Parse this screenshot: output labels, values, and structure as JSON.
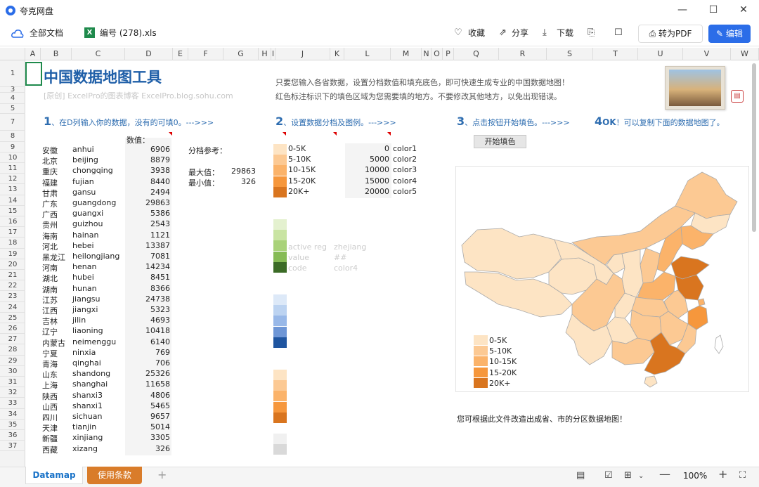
{
  "window": {
    "app_name": "夸克网盘",
    "min": "—",
    "max": "☐",
    "close": "✕"
  },
  "toolbar": {
    "all_docs": "全部文档",
    "file_name": "编号 (278).xls",
    "favorite": "收藏",
    "share": "分享",
    "download": "下载",
    "to_pdf": "转为PDF",
    "edit": "编辑"
  },
  "columns": [
    "A",
    "B",
    "C",
    "D",
    "E",
    "F",
    "G",
    "H",
    "I",
    "J",
    "K",
    "L",
    "M",
    "N",
    "O",
    "P",
    "Q",
    "R",
    "S",
    "T",
    "U",
    "V",
    "W"
  ],
  "rows": [
    "1",
    "3",
    "4",
    "5",
    "7",
    "8",
    "9",
    "10",
    "11",
    "12",
    "13",
    "14",
    "15",
    "16",
    "17",
    "18",
    "19",
    "20",
    "21",
    "22",
    "23",
    "24",
    "25",
    "26",
    "27",
    "28",
    "29",
    "30",
    "31",
    "32",
    "33",
    "34",
    "35",
    "36",
    "37"
  ],
  "sheet": {
    "title": "中国数据地图工具",
    "subtitle": "[原创] ExcelPro的图表博客 ExcelPro.blog.sohu.com",
    "intro1": "只要您输入各省数据，设置分档数值和填充底色，即可快速生成专业的中国数据地图！",
    "intro2": "红色标注标识下的填色区域为您需要填的地方。不要修改其他地方，以免出现错误。",
    "step1_num": "1",
    "step1_text": "、在D列输入你的数据，没有的可填0。--->>>",
    "step2_num": "2",
    "step2_text": "、设置数据分档及图例。--->>>",
    "step3_num": "3",
    "step3_text": "、点击按钮开始填色。--->>>",
    "step4_num": "4",
    "step4_ok": "OK",
    "step4_text": "！可以复制下面的数据地图了。",
    "value_header": "数值：",
    "fill_button": "开始填色",
    "ref_label": "分档参考：",
    "max_label": "最大值：",
    "max_value": "29863",
    "min_label": "最小值：",
    "min_value": "326",
    "bottom_note": "您可根据此文件改造出成省、市的分区数据地图！",
    "hidden1_a": "active reg",
    "hidden1_b": "zhejiang",
    "hidden2_a": "value",
    "hidden2_b": "##",
    "hidden3_a": "code",
    "hidden3_b": "color4"
  },
  "provinces": [
    {
      "cn": "安徽",
      "py": "anhui",
      "v": "6906"
    },
    {
      "cn": "北京",
      "py": "beijing",
      "v": "8879"
    },
    {
      "cn": "重庆",
      "py": "chongqing",
      "v": "3938"
    },
    {
      "cn": "福建",
      "py": "fujian",
      "v": "8440"
    },
    {
      "cn": "甘肃",
      "py": "gansu",
      "v": "2494"
    },
    {
      "cn": "广东",
      "py": "guangdong",
      "v": "29863"
    },
    {
      "cn": "广西",
      "py": "guangxi",
      "v": "5386"
    },
    {
      "cn": "贵州",
      "py": "guizhou",
      "v": "2543"
    },
    {
      "cn": "海南",
      "py": "hainan",
      "v": "1121"
    },
    {
      "cn": "河北",
      "py": "hebei",
      "v": "13387"
    },
    {
      "cn": "黑龙江",
      "py": "heilongjiang",
      "v": "7081"
    },
    {
      "cn": "河南",
      "py": "henan",
      "v": "14234"
    },
    {
      "cn": "湖北",
      "py": "hubei",
      "v": "8451"
    },
    {
      "cn": "湖南",
      "py": "hunan",
      "v": "8366"
    },
    {
      "cn": "江苏",
      "py": "jiangsu",
      "v": "24738"
    },
    {
      "cn": "江西",
      "py": "jiangxi",
      "v": "5323"
    },
    {
      "cn": "吉林",
      "py": "jilin",
      "v": "4693"
    },
    {
      "cn": "辽宁",
      "py": "liaoning",
      "v": "10418"
    },
    {
      "cn": "内蒙古",
      "py": "neimenggu",
      "v": "6140"
    },
    {
      "cn": "宁夏",
      "py": "ninxia",
      "v": "769"
    },
    {
      "cn": "青海",
      "py": "qinghai",
      "v": "706"
    },
    {
      "cn": "山东",
      "py": "shandong",
      "v": "25326"
    },
    {
      "cn": "上海",
      "py": "shanghai",
      "v": "11658"
    },
    {
      "cn": "陕西",
      "py": "shanxi3",
      "v": "4806"
    },
    {
      "cn": "山西",
      "py": "shanxi1",
      "v": "5465"
    },
    {
      "cn": "四川",
      "py": "sichuan",
      "v": "9657"
    },
    {
      "cn": "天津",
      "py": "tianjin",
      "v": "5014"
    },
    {
      "cn": "新疆",
      "py": "xinjiang",
      "v": "3305"
    },
    {
      "cn": "西藏",
      "py": "xizang",
      "v": "326"
    }
  ],
  "bins": [
    {
      "label": "0-5K",
      "lower": "0",
      "color_name": "color1",
      "hex": "#fde4c4"
    },
    {
      "label": "5-10K",
      "lower": "5000",
      "color_name": "color2",
      "hex": "#fcc993"
    },
    {
      "label": "10-15K",
      "lower": "10000",
      "color_name": "color3",
      "hex": "#fbb36a"
    },
    {
      "label": "15-20K",
      "lower": "15000",
      "color_name": "color4",
      "hex": "#f6973c"
    },
    {
      "label": "20K+",
      "lower": "20000",
      "color_name": "color5",
      "hex": "#d9751f"
    }
  ],
  "legend": [
    "0-5K",
    "5-10K",
    "10-15K",
    "15-20K",
    "20K+"
  ],
  "palettes": {
    "green": [
      "#e4f1cf",
      "#c9e4a2",
      "#a9d279",
      "#86bb55",
      "#3b6b26"
    ],
    "blue": [
      "#dde9f8",
      "#bcd3f1",
      "#98b8e8",
      "#6e96d6",
      "#1f55a0"
    ],
    "orange": [
      "#fde4c4",
      "#fcc993",
      "#fbb36a",
      "#f6973c",
      "#d9751f"
    ],
    "gray": [
      "#f0f0f0",
      "#d9d9d9"
    ]
  },
  "statusbar": {
    "sheet_tab": "Datamap",
    "terms_tab": "使用条款",
    "add": "+",
    "zoom": "100%"
  }
}
